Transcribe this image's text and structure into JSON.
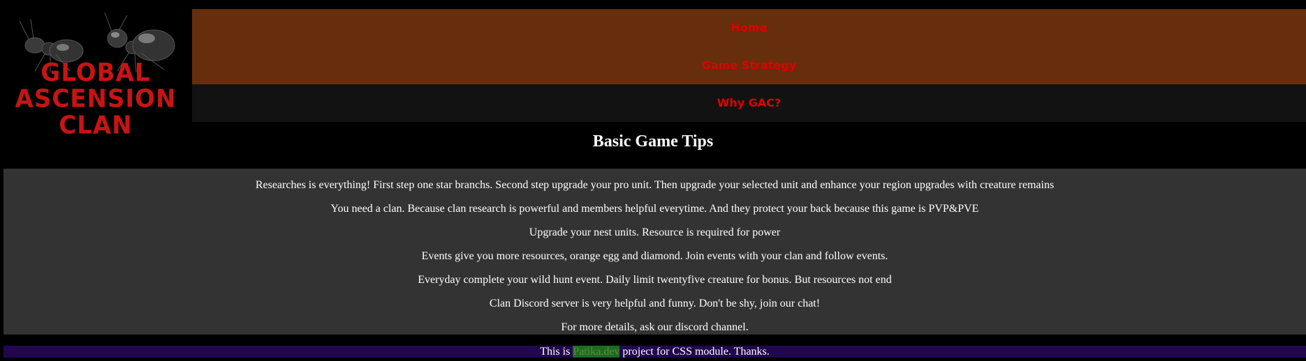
{
  "logo": {
    "text_line1": "GLOBAL ASCENSION",
    "text_line2": "CLAN"
  },
  "nav": {
    "items": [
      {
        "label": "Home"
      },
      {
        "label": "Game Strategy"
      },
      {
        "label": "Why GAC?"
      }
    ]
  },
  "main": {
    "title": "Basic Game Tips",
    "tips": [
      "Researches is everything! First step one star branchs. Second step upgrade your pro unit. Then upgrade your selected unit and enhance your region upgrades with creature remains",
      "You need a clan. Because clan research is powerful and members helpful everytime. And they protect your back because this game is PVP&PVE",
      "Upgrade your nest units. Resource is required for power",
      "Events give you more resources, orange egg and diamond. Join events with your clan and follow events.",
      "Everyday complete your wild hunt event. Daily limit twentyfive creature for bonus. But resources not end",
      "Clan Discord server is very helpful and funny. Don't be shy, join our chat!",
      "For more details, ask our discord channel."
    ]
  },
  "footer": {
    "prefix": "This is ",
    "link_text": "Patika.dev",
    "suffix": " project for CSS module. Thanks."
  },
  "colors": {
    "nav_brown": "#662e0c",
    "nav_dark": "#121212",
    "nav_text": "#e00000",
    "tips_bg": "#333333",
    "footer_bg": "#21074d",
    "logo_red": "#c81414"
  }
}
